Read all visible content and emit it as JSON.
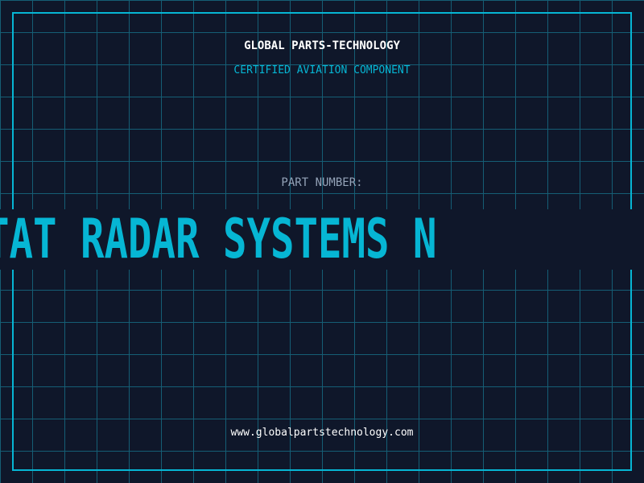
{
  "header": {
    "title": "GLOBAL PARTS-TECHNOLOGY",
    "subtitle": "CERTIFIED AVIATION COMPONENT"
  },
  "part": {
    "label": "PART NUMBER:",
    "value_visible": "TAT RADAR SYSTEMS N"
  },
  "footer": {
    "url": "www.globalpartstechnology.com"
  },
  "colors": {
    "background": "#0f172a",
    "grid": "#155e75",
    "accent": "#06b6d4",
    "label": "#94a3b8"
  }
}
